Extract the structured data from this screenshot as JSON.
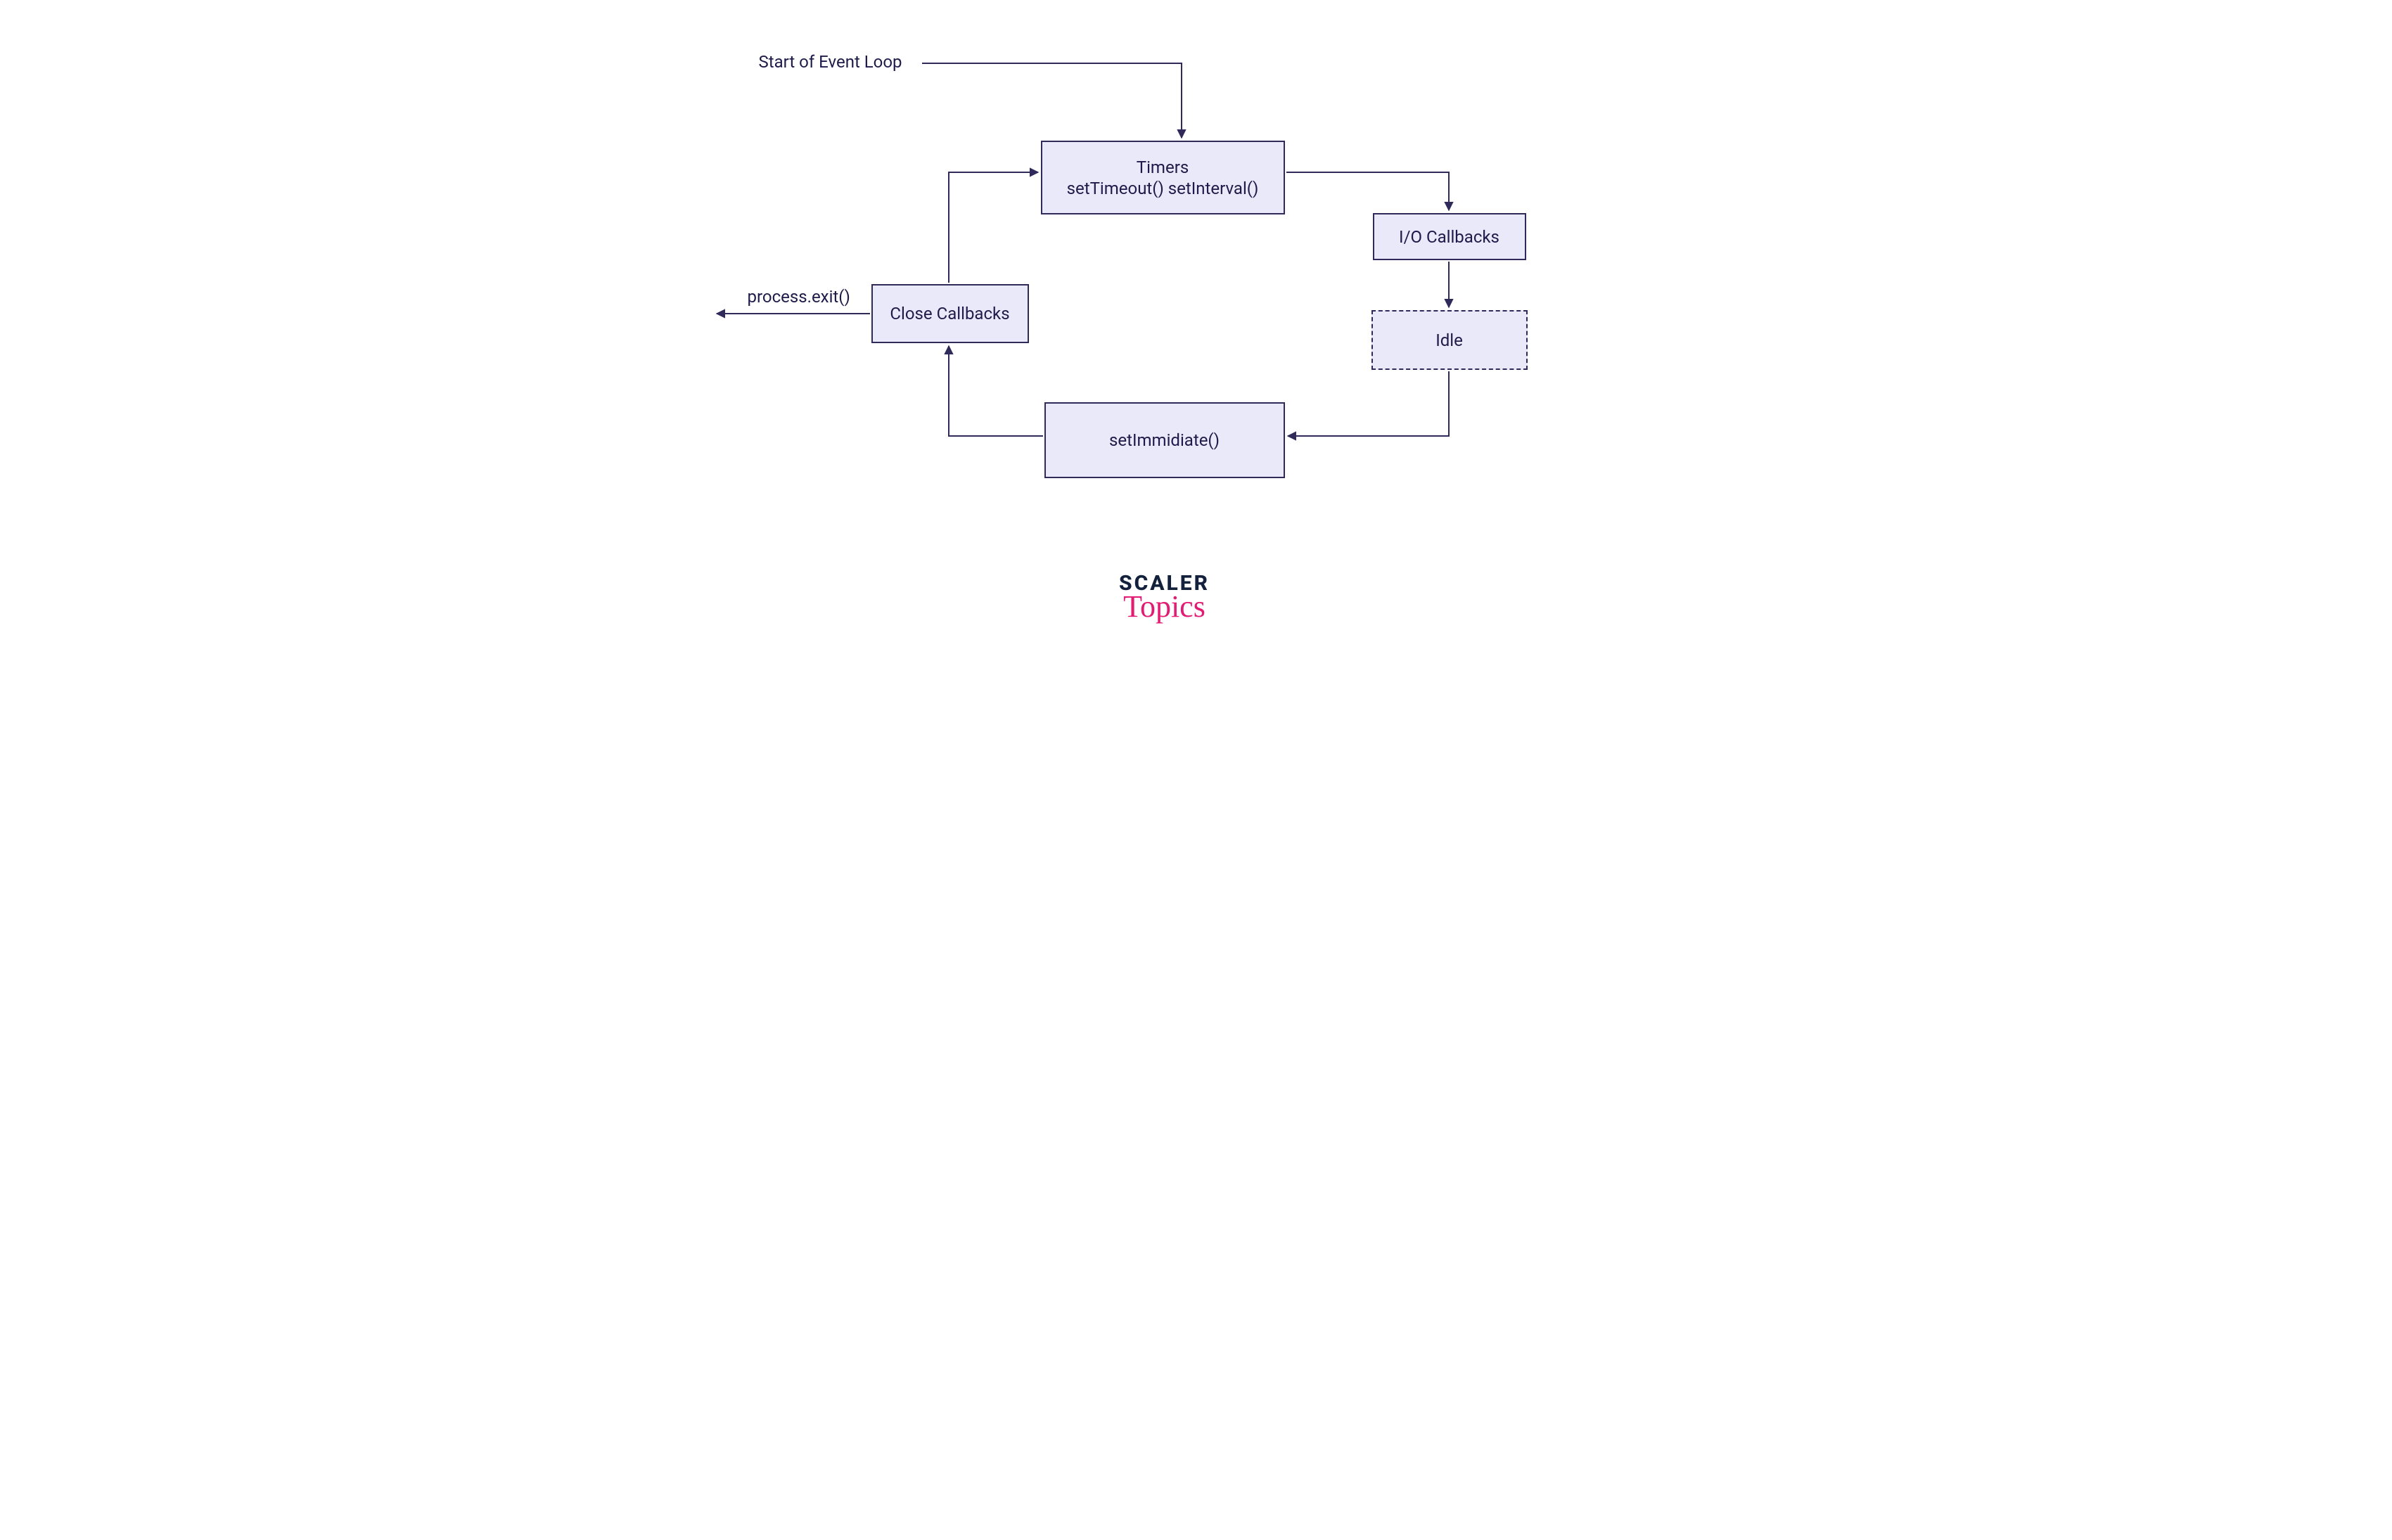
{
  "labels": {
    "start": "Start of Event Loop",
    "exit": "process.exit()"
  },
  "nodes": {
    "timers": {
      "line1": "Timers",
      "line2": "setTimeout() setInterval()"
    },
    "io": "I/O Callbacks",
    "idle": "Idle",
    "setimm": "setImmidiate()",
    "close": "Close Callbacks"
  },
  "logo": {
    "top": "SCALER",
    "bottom": "Topics"
  },
  "colors": {
    "stroke": "#2f2a5a",
    "fill": "#e9e9f9",
    "textdark": "#1e1b4b",
    "brandpink": "#e31b72",
    "branddark": "#14213d"
  }
}
